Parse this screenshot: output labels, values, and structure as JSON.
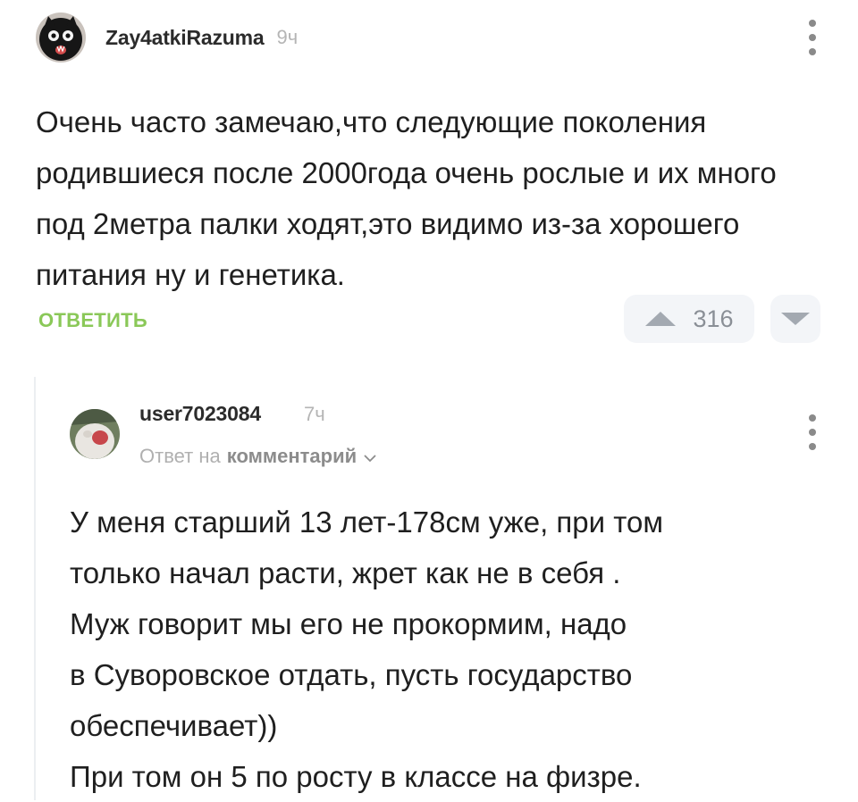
{
  "comment": {
    "username": "Zay4atkiRazuma",
    "time": "9ч",
    "text": "Очень часто замечаю,что следующие поколения родившиеся после 2000года очень рослые и их много под 2метра палки ходят,это видимо из-за хорошего питания ну и генетика.",
    "reply_label": "ОТВЕТИТЬ",
    "rating": "316"
  },
  "reply": {
    "username": "user7023084",
    "time": "7ч",
    "reply_prefix": "Ответ на",
    "reply_target": "комментарий",
    "lines": [
      "У меня старший 13 лет-178см уже, при том",
      "только начал расти, жрет как не в себя .",
      "Муж говорит мы его не прокормим, надо",
      "в Суворовское отдать, пусть государство",
      "обеспечивает))",
      "При том он 5 по росту в классе на физре."
    ]
  },
  "icons": {
    "menu": "more-vertical-icon",
    "upvote": "triangle-up-icon",
    "downvote": "triangle-down-icon",
    "expand": "chevron-down-icon"
  },
  "colors": {
    "reply_link": "#8ac858",
    "vote_bg": "#f3f5f8",
    "meta": "#b5b5b5"
  }
}
